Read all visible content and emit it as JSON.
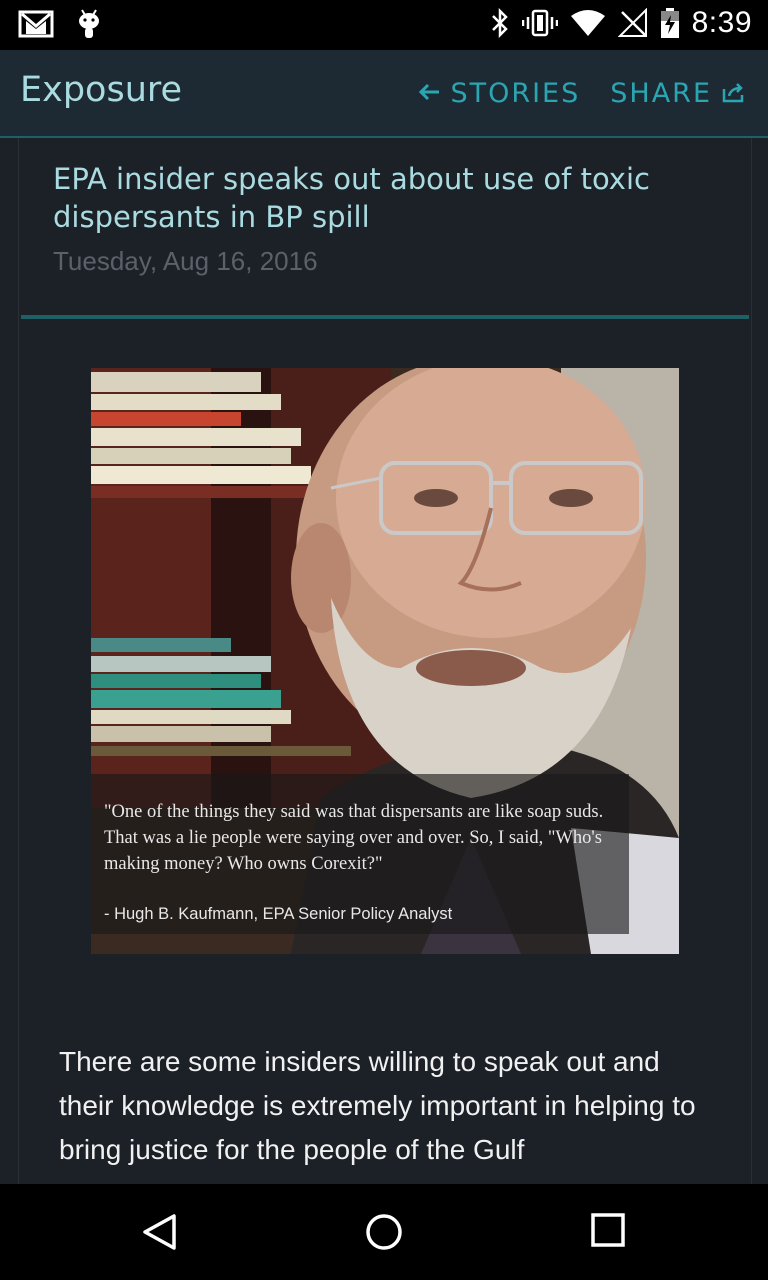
{
  "status_bar": {
    "time": "8:39",
    "icons": [
      "gmail-icon",
      "android-icon",
      "bluetooth-icon",
      "vibrate-icon",
      "wifi-icon",
      "no-signal-icon",
      "battery-charging-icon"
    ]
  },
  "app_bar": {
    "title": "Exposure",
    "stories_label": "STORIES",
    "share_label": "SHARE",
    "accent_color": "#2aa6b3",
    "title_color": "#a9dbe1"
  },
  "article": {
    "headline": "EPA insider speaks out about use of toxic dispersants in BP spill",
    "date": "Tuesday, Aug 16, 2016",
    "image": {
      "subject": "portrait photo of bearded man with glasses",
      "quote": "\"One of the things they said was that dispersants are like soap suds. That was a lie people were saying over and over.  So, I said, \"Who's making money? Who owns Corexit?\"",
      "attribution": "-  Hugh B. Kaufmann, EPA Senior Policy Analyst"
    },
    "body": "There are some insiders willing to speak out and their knowledge is extremely important in helping to bring justice for the people of the Gulf"
  },
  "nav_bar": {
    "buttons": [
      "back-icon",
      "home-icon",
      "recents-icon"
    ]
  }
}
